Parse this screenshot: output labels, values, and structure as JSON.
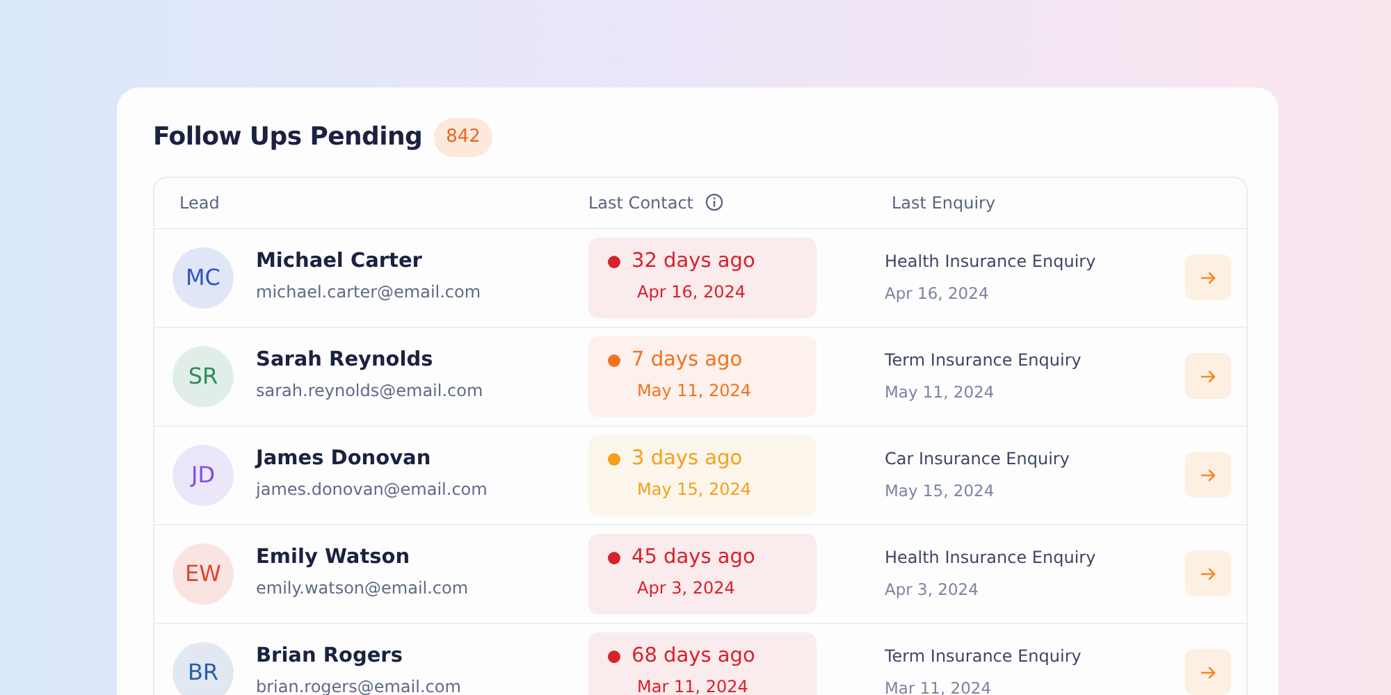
{
  "panel": {
    "title": "Follow Ups Pending",
    "count": "842"
  },
  "table": {
    "columns": [
      {
        "label": "Lead",
        "info": false
      },
      {
        "label": "Last Contact",
        "info": true
      },
      {
        "label": "Last Enquiry",
        "info": false
      }
    ],
    "rows": [
      {
        "initials": "MC",
        "color": "#2f54c4",
        "name": "Michael Carter",
        "email": "michael.carter@email.com",
        "contact": {
          "ago": "32 days ago",
          "date": "Apr 16, 2024",
          "color": "#d7222b"
        },
        "enquiry": {
          "title": "Health Insurance Enquiry",
          "date": "Apr 16, 2024"
        }
      },
      {
        "initials": "SR",
        "color": "#2e8b57",
        "name": "Sarah Reynolds",
        "email": "sarah.reynolds@email.com",
        "contact": {
          "ago": "7 days ago",
          "date": "May 11, 2024",
          "color": "#f27220"
        },
        "enquiry": {
          "title": "Term Insurance Enquiry",
          "date": "May 11, 2024"
        }
      },
      {
        "initials": "JD",
        "color": "#7b4fe0",
        "name": "James Donovan",
        "email": "james.donovan@email.com",
        "contact": {
          "ago": "3 days ago",
          "date": "May 15, 2024",
          "color": "#f2a11a"
        },
        "enquiry": {
          "title": "Car Insurance Enquiry",
          "date": "May 15, 2024"
        }
      },
      {
        "initials": "EW",
        "color": "#e0452c",
        "name": "Emily Watson",
        "email": "emily.watson@email.com",
        "contact": {
          "ago": "45 days ago",
          "date": "Apr 3, 2024",
          "color": "#d7222b"
        },
        "enquiry": {
          "title": "Health Insurance Enquiry",
          "date": "Apr 3, 2024"
        }
      },
      {
        "initials": "BR",
        "color": "#2a5ea8",
        "name": "Brian Rogers",
        "email": "brian.rogers@email.com",
        "contact": {
          "ago": "68 days ago",
          "date": "Mar 11, 2024",
          "color": "#d7222b"
        },
        "enquiry": {
          "title": "Term Insurance Enquiry",
          "date": "Mar 11, 2024"
        }
      }
    ]
  }
}
